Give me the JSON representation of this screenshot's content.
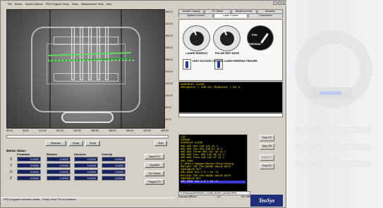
{
  "menu": [
    "File",
    "Motion",
    "System Options",
    "PSO Program Setup",
    "Views",
    "Measurement Tools",
    "Help"
  ],
  "x_ticks": [
    "48.00",
    "96.00",
    "144.00",
    "192.00",
    "240.00",
    "288.00",
    "336.00",
    "384.00",
    "432.00",
    "480.00"
  ],
  "y_ticks": [
    "480.00",
    "432.00",
    "384.00",
    "336.00",
    "288.00",
    "240.00",
    "192.00",
    "144.00",
    "96.00",
    "48.00"
  ],
  "buttons": {
    "redraw": "Redraw",
    "snap": "Snap",
    "grab": "Grab",
    "exit": "Exit",
    "abort": "Abort F2",
    "joystick": "Joystick",
    "home": "Go Home",
    "pages": "Pages F3",
    "run": "Run F5",
    "step": "Step F8",
    "back": "Back F7",
    "end": "End F8"
  },
  "motion": {
    "title": "Motion Status",
    "headers": [
      "Feedback",
      "Relative",
      "Absolute",
      "Velocity"
    ],
    "rows": [
      {
        "axis": "X",
        "values": [
          "0.0000",
          "0.0000",
          "0.0000",
          "0.0000"
        ]
      },
      {
        "axis": "Y",
        "values": [
          "0.0000",
          "0.0000",
          "0.0000",
          "0.0000"
        ]
      },
      {
        "axis": "U",
        "values": [
          "0.0000",
          "0.0000",
          "0.0000",
          "0.0000"
        ]
      },
      {
        "axis": "Z",
        "values": [
          "0.0000",
          "0.0000",
          "0.0000",
          "0.0000"
        ]
      }
    ]
  },
  "status": "PSO program execution break... Press <Run F5> to continue.",
  "tabs": {
    "row1": [
      "Variable Display",
      "I/O Status",
      "Measurements",
      "Variables"
    ],
    "row2": [
      "System Control",
      "Laser Control",
      "Parameters"
    ]
  },
  "laser": {
    "energy_label": "LASER ENERGY",
    "rate_label": "PULSE REP RATE",
    "modes": [
      "OFF",
      "PSO",
      "FREERUN",
      "BURST"
    ],
    "left_switch": "HIGH VOLTAGE CONTROL",
    "right_switch": "LASER FREERUN TRIGGER"
  },
  "console_top": [
    "#OVERLAY CLEAR",
    "#Midpoint = 166.32, Midpoint = 92.4"
  ],
  "console_bottom": [
    "LIM",
    "CURSOR",
    "#OVERLAY CLEAR",
    "",
    "#RD ADD One 118 121 11 1",
    "#RD ADD Two 252 130 57 12 1",
    "#RD ADD Three 305 147 58 14 1",
    "#RD ADD Four 368 129 68 12 1",
    "#RD ADD Five 418 132 67 12 1",
    "#RD LOAD D:\\MYDir\\Images\\Marker\\Pins\\Config",
    "REPLACE THE FOLLOWING VALUE WITH VARIABLES SET",
    "#RD EDGE One 1 0 + #1 +2",
    "REPLACE THE FOLLOWING VALUE WITH VARIABLES SET",
    "#RD EDGE Two 1 0 + #1 +2"
  ],
  "footer_path": "F:\\Pictures\\MVPIG\\MY_COMB_EDGE_DILATE.PRG",
  "footer_status": [
    "Execution BREAK",
    "CH",
    "375 / 380"
  ],
  "brand": "TeoSys"
}
